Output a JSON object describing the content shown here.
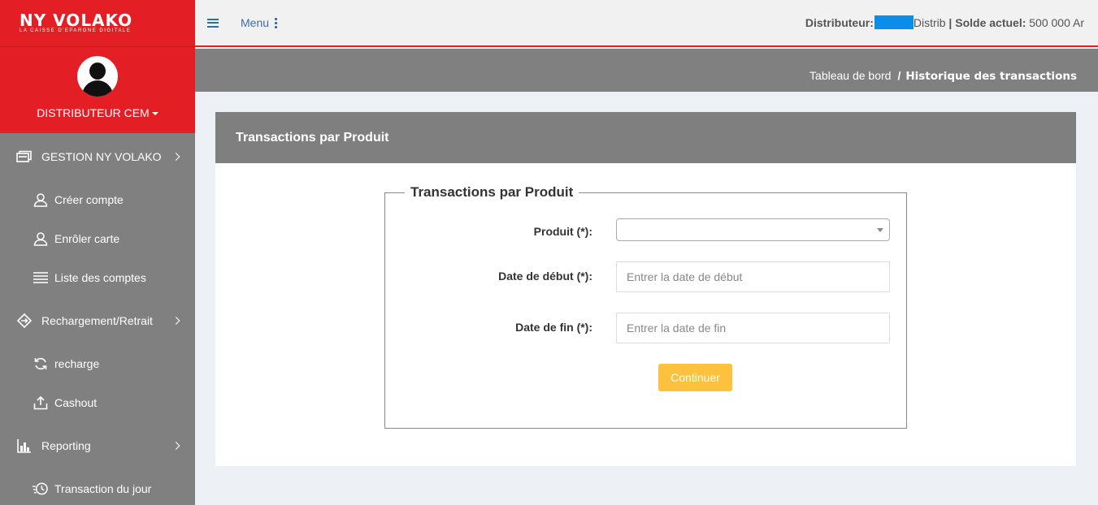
{
  "brand": {
    "name": "NY VOLAKO",
    "tagline": "LA CAISSE D'EPARGNE DIGITALE",
    "color": "#e31e24"
  },
  "profile": {
    "name": "DISTRIBUTEUR CEM"
  },
  "sidebar": {
    "sections": [
      {
        "label": "GESTION NY VOLAKO",
        "icon": "wallet-icon",
        "items": [
          {
            "label": "Créer compte",
            "icon": "user-icon"
          },
          {
            "label": "Enrôler carte",
            "icon": "user-icon"
          },
          {
            "label": "Liste des comptes",
            "icon": "list-icon"
          }
        ]
      },
      {
        "label": "Rechargement/Retrait",
        "icon": "exchange-icon",
        "items": [
          {
            "label": "recharge",
            "icon": "refresh-icon"
          },
          {
            "label": "Cashout",
            "icon": "upload-icon"
          }
        ]
      },
      {
        "label": "Reporting",
        "icon": "chart-icon",
        "items": [
          {
            "label": "Transaction du jour",
            "icon": "clock-icon"
          }
        ]
      }
    ]
  },
  "topbar": {
    "menu_label": "Menu",
    "distributor_label": "Distributeur:",
    "distributor_suffix": "Distrib",
    "separator": "|",
    "balance_label": "Solde actuel:",
    "balance_value": "500 000 Ar"
  },
  "breadcrumb": {
    "home": "Tableau de bord",
    "separator": "/",
    "current": "Historique des transactions"
  },
  "card": {
    "title": "Transactions par Produit",
    "fieldset_title": "Transactions par Produit",
    "fields": {
      "product_label": "Produit (*):",
      "product_value": "",
      "start_label": "Date de début (*):",
      "start_placeholder": "Entrer la date de début",
      "end_label": "Date de fin (*):",
      "end_placeholder": "Entrer la date de fin"
    },
    "submit_label": "Continuer"
  },
  "colors": {
    "sidebar": "#808080",
    "accent": "#e31e24",
    "button": "#fcc23d",
    "redaction": "#0b8de9"
  }
}
